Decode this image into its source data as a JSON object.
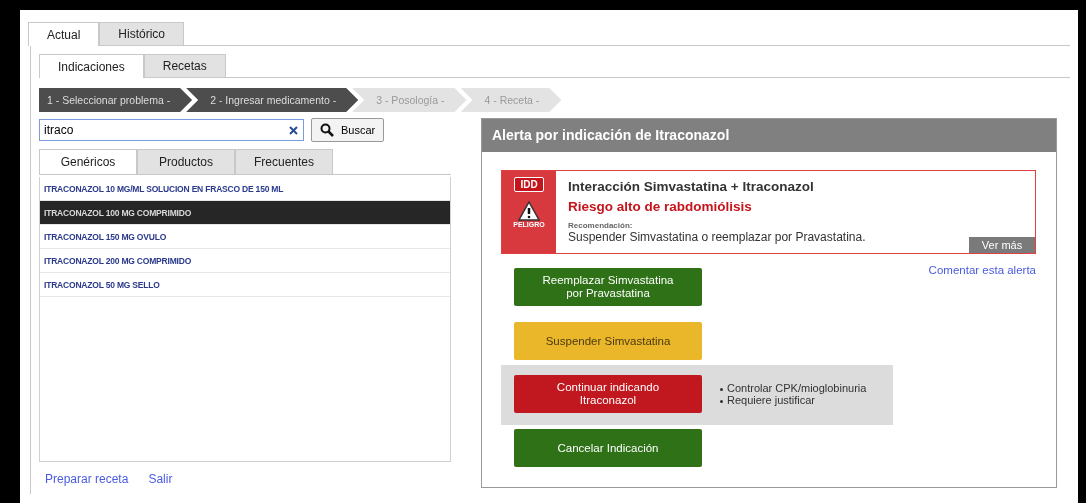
{
  "main_tabs": [
    {
      "label": "Actual",
      "selected": true
    },
    {
      "label": "Histórico",
      "selected": false
    }
  ],
  "sub_tabs": [
    {
      "label": "Indicaciones",
      "selected": true
    },
    {
      "label": "Recetas",
      "selected": false
    }
  ],
  "steps": [
    {
      "label": "1 - Seleccionar problema -",
      "active": true
    },
    {
      "label": "2 - Ingresar medicamento -",
      "active": true
    },
    {
      "label": "3 - Posología -",
      "active": false
    },
    {
      "label": "4 - Receta -",
      "active": false
    }
  ],
  "search": {
    "value": "itraco",
    "button": "Buscar"
  },
  "list_tabs": [
    {
      "label": "Genéricos",
      "selected": true
    },
    {
      "label": "Productos",
      "selected": false
    },
    {
      "label": "Frecuentes",
      "selected": false
    }
  ],
  "results": [
    {
      "label": "ITRACONAZOL 10 MG/ML SOLUCION EN FRASCO DE 150 ML",
      "selected": false
    },
    {
      "label": "ITRACONAZOL 100 MG COMPRIMIDO",
      "selected": true
    },
    {
      "label": "ITRACONAZOL 150 MG OVULO",
      "selected": false
    },
    {
      "label": "ITRACONAZOL 200 MG COMPRIMIDO",
      "selected": false
    },
    {
      "label": "ITRACONAZOL 50 MG SELLO",
      "selected": false
    }
  ],
  "footer_links": [
    "Preparar receta",
    "Salir"
  ],
  "alert": {
    "title": "Alerta por indicación de Itraconazol",
    "card": {
      "badge": "IDD",
      "severity": "PELIGRO",
      "heading": "Interacción Simvastatina + Itraconazol",
      "risk": "Riesgo alto de rabdomiólisis",
      "recommendation_label": "Recomendación:",
      "recommendation": "Suspender Simvastatina o reemplazar por Pravastatina.",
      "more": "Ver más"
    },
    "comment_link": "Comentar esta alerta",
    "actions": [
      {
        "label": "Reemplazar Simvastatina por Pravastatina",
        "color": "#2e7116"
      },
      {
        "label": "Suspender Simvastatina",
        "color": "#ebb72a"
      },
      {
        "label": "Continuar indicando Itraconazol",
        "color": "#c1171e",
        "notes": [
          "Controlar CPK/mioglobinuria",
          "Requiere justificar"
        ]
      },
      {
        "label": "Cancelar Indicación",
        "color": "#2e7116"
      }
    ]
  }
}
